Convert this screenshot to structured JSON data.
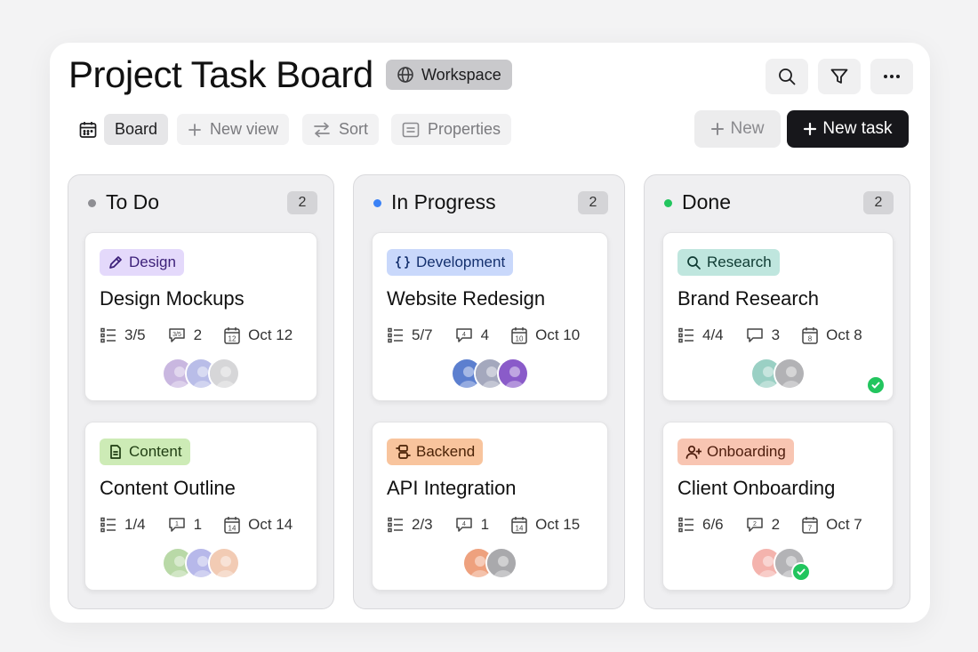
{
  "header": {
    "title": "Project Task Board",
    "workspace_label": "Workspace"
  },
  "toolbar": {
    "board": "Board",
    "new_view": "New view",
    "sort": "Sort",
    "properties": "Properties",
    "new": "New",
    "new_task": "New task"
  },
  "columns": [
    {
      "title": "To Do",
      "count": "2",
      "dot_color": "#8e8e93",
      "cards": [
        {
          "tag": "Design",
          "tag_icon": "pencil-icon",
          "tag_bg": "#e4d9fb",
          "tag_color": "#3b1f78",
          "title": "Design Mockups",
          "subtasks": "3/5",
          "comments": "2",
          "comment_icon_text": "3/5",
          "date": "Oct 12",
          "date_day": "12",
          "avatars": [
            "#c9b7e0",
            "#b9bde8",
            "#d6d6d8"
          ]
        },
        {
          "tag": "Content",
          "tag_icon": "document-icon",
          "tag_bg": "#cdebb6",
          "tag_color": "#1f3d12",
          "title": "Content Outline",
          "subtasks": "1/4",
          "comments": "1",
          "comment_icon_text": "1",
          "date": "Oct 14",
          "date_day": "14",
          "avatars": [
            "#b9d9a7",
            "#b7b8ea",
            "#f2cbb4"
          ]
        }
      ]
    },
    {
      "title": "In Progress",
      "count": "2",
      "dot_color": "#3b82f6",
      "cards": [
        {
          "tag": "Development",
          "tag_icon": "code-icon",
          "tag_bg": "#c9d8fb",
          "tag_color": "#14306e",
          "title": "Website Redesign",
          "subtasks": "5/7",
          "comments": "4",
          "comment_icon_text": "4",
          "date": "Oct 10",
          "date_day": "10",
          "avatars": [
            "#5c7fcf",
            "#a4a8bd",
            "#8a5bc9"
          ]
        },
        {
          "tag": "Backend",
          "tag_icon": "server-icon",
          "tag_bg": "#f8c49d",
          "tag_color": "#4a2206",
          "title": "API Integration",
          "subtasks": "2/3",
          "comments": "1",
          "comment_icon_text": "4",
          "date": "Oct 15",
          "date_day": "14",
          "avatars": [
            "#eea17e",
            "#a9a9ac"
          ]
        }
      ]
    },
    {
      "title": "Done",
      "count": "2",
      "dot_color": "#22c55e",
      "cards": [
        {
          "tag": "Research",
          "tag_icon": "search-icon",
          "tag_bg": "#bfe6de",
          "tag_color": "#0f3b33",
          "title": "Brand Research",
          "subtasks": "4/4",
          "comments": "3",
          "comment_icon_text": "",
          "date": "Oct 8",
          "date_day": "8",
          "avatars": [
            "#9ad0c4",
            "#b2b2b5"
          ]
        },
        {
          "tag": "Onboarding",
          "tag_icon": "user-add-icon",
          "tag_bg": "#f8c5b2",
          "tag_color": "#4d1c0c",
          "title": "Client Onboarding",
          "subtasks": "6/6",
          "comments": "2",
          "comment_icon_text": "2",
          "date": "Oct 7",
          "date_day": "7",
          "avatars": [
            "#f4b3ad",
            "#b3b3b6"
          ]
        }
      ]
    }
  ]
}
